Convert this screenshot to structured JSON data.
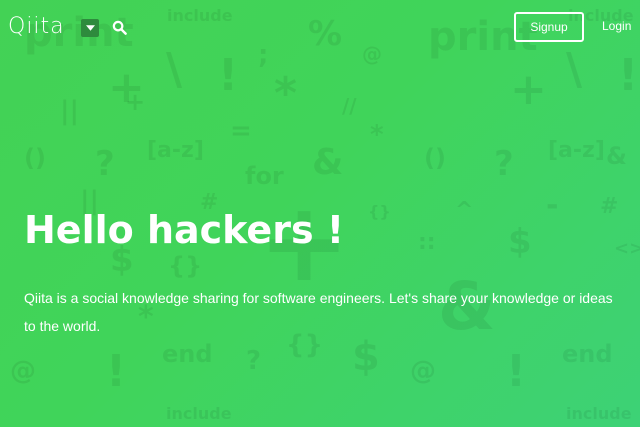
{
  "header": {
    "logo_text": "Qiita",
    "signup_label": "Signup",
    "login_label": "Login"
  },
  "hero": {
    "title": "Hello hackers !",
    "description": "Qiita is a social knowledge sharing for software engineers. Let's share your knowledge or ideas to the world."
  },
  "background": {
    "symbols": [
      "include",
      "print",
      ";",
      "%",
      "@",
      "print",
      "include",
      "\\",
      "!",
      "+",
      "*",
      "+",
      "\\",
      "!",
      "||",
      "//",
      "*",
      "+",
      "[a-z]",
      "=",
      "[a-z]",
      "()",
      "?",
      "&",
      "for",
      "()",
      "?",
      "&",
      "#",
      "-",
      "^",
      "#",
      "||",
      "{}",
      "+",
      "$",
      "<>",
      "{}",
      "::",
      "$",
      "&",
      "*",
      "end",
      "{}",
      "end",
      "@",
      "!",
      "?",
      "$",
      "@",
      "!",
      "include",
      "include"
    ]
  },
  "colors": {
    "accent": "#40d45a",
    "dropdown_bg": "#2e8b3d"
  },
  "icons": {
    "dropdown": "chevron-down-icon",
    "search": "search-icon"
  }
}
